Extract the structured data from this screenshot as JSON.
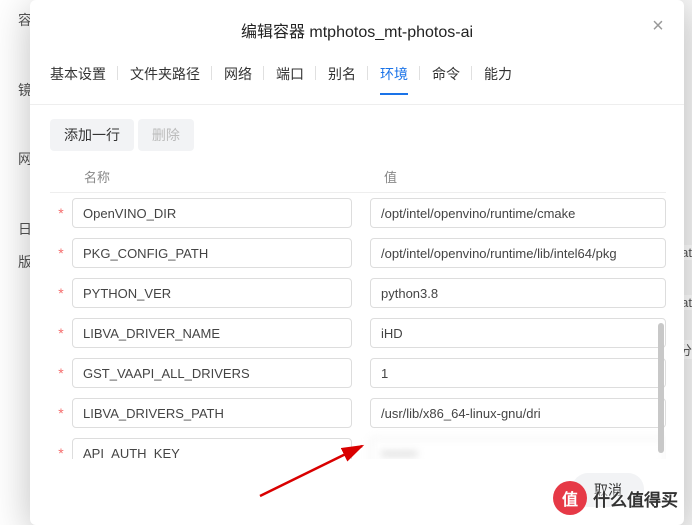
{
  "modal": {
    "title_prefix": "编辑容器",
    "title_name": "mtphotos_mt-photos-ai",
    "close_icon": "×"
  },
  "tabs": [
    {
      "label": "基本设置"
    },
    {
      "label": "文件夹路径"
    },
    {
      "label": "网络"
    },
    {
      "label": "端口"
    },
    {
      "label": "别名"
    },
    {
      "label": "环境",
      "active": true
    },
    {
      "label": "命令"
    },
    {
      "label": "能力"
    }
  ],
  "toolbar": {
    "add_label": "添加一行",
    "delete_label": "删除"
  },
  "columns": {
    "name": "名称",
    "value": "值"
  },
  "rows": [
    {
      "name": "OpenVINO_DIR",
      "value": "/opt/intel/openvino/runtime/cmake"
    },
    {
      "name": "PKG_CONFIG_PATH",
      "value": "/opt/intel/openvino/runtime/lib/intel64/pkg"
    },
    {
      "name": "PYTHON_VER",
      "value": "python3.8"
    },
    {
      "name": "LIBVA_DRIVER_NAME",
      "value": "iHD"
    },
    {
      "name": "GST_VAAPI_ALL_DRIVERS",
      "value": "1"
    },
    {
      "name": "LIBVA_DRIVERS_PATH",
      "value": "/usr/lib/x86_64-linux-gnu/dri"
    },
    {
      "name": "API_AUTH_KEY",
      "value": ":blurred",
      "blur": true
    }
  ],
  "footer": {
    "cancel": "取消"
  },
  "bg": {
    "l1": "容器",
    "l2": "镜",
    "l3": "网",
    "l4": "日",
    "l5": "版本",
    "r1": "at",
    "r2": "at",
    "r3": "分"
  },
  "watermark": {
    "badge": "值",
    "text": "什么值得买"
  }
}
